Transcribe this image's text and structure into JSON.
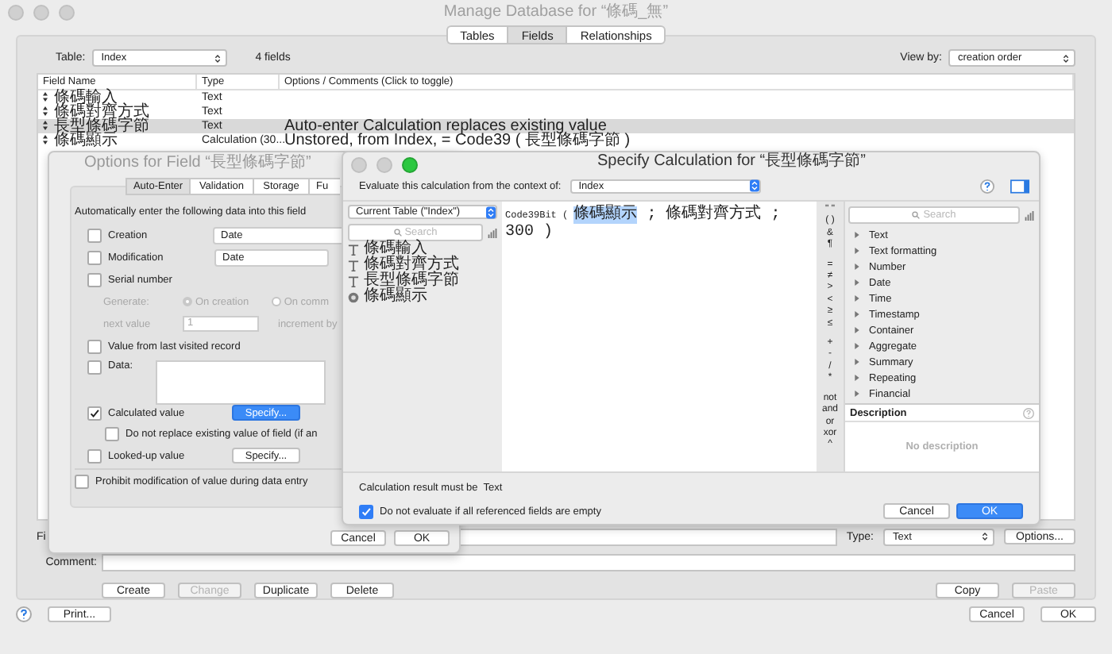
{
  "window": {
    "title": "Manage Database for “條碼_無”"
  },
  "tabs": [
    {
      "label": "Tables",
      "selected": false
    },
    {
      "label": "Fields",
      "selected": true
    },
    {
      "label": "Relationships",
      "selected": false
    }
  ],
  "table_picker": {
    "label": "Table:",
    "value": "Index"
  },
  "field_count": "4 fields",
  "view_by": {
    "label": "View by:",
    "value": "creation order"
  },
  "field_list": {
    "columns": [
      "Field Name",
      "Type",
      "Options / Comments  (Click to toggle)"
    ],
    "rows": [
      {
        "name": "條碼輸入",
        "type": "Text",
        "selected": false
      },
      {
        "name": "條碼對齊方式",
        "type": "Text",
        "selected": false
      },
      {
        "name": "長型條碼字節",
        "type": "Text",
        "options": "Auto-enter Calculation replaces existing value",
        "selected": true
      },
      {
        "name": "條碼顯示",
        "type": "Calculation (30...",
        "options": "Unstored, from Index, = Code39 ( 長型條碼字節 )",
        "selected": false
      }
    ]
  },
  "field_name": {
    "label": "Fi"
  },
  "type_picker": {
    "label": "Type:",
    "value": "Text"
  },
  "options_button": "Options...",
  "comment": {
    "label": "Comment:"
  },
  "edit_buttons": [
    {
      "label": "Create",
      "disabled": false
    },
    {
      "label": "Change",
      "disabled": true
    },
    {
      "label": "Duplicate",
      "disabled": false
    },
    {
      "label": "Delete",
      "disabled": false
    }
  ],
  "clipboard_buttons": [
    {
      "label": "Copy",
      "disabled": false
    },
    {
      "label": "Paste",
      "disabled": true
    }
  ],
  "footer": {
    "print": "Print...",
    "cancel": "Cancel",
    "ok": "OK"
  },
  "options_dialog": {
    "title": "Options for Field “長型條碼字節”",
    "tabs": [
      {
        "label": "Auto-Enter",
        "selected": true
      },
      {
        "label": "Validation",
        "selected": false
      },
      {
        "label": "Storage",
        "selected": false
      },
      {
        "label": "Fu",
        "selected": false
      }
    ],
    "heading": "Automatically enter the following data into this field",
    "rows": [
      {
        "kind": "checkbox_select",
        "label": "Creation",
        "checked": false,
        "value": "Date"
      },
      {
        "kind": "checkbox_select",
        "label": "Modification",
        "checked": false,
        "value": "Date"
      },
      {
        "kind": "checkbox",
        "label": "Serial number",
        "checked": false
      },
      {
        "kind": "radio_group",
        "label": "Generate:",
        "disabled": true,
        "options": [
          {
            "label": "On creation",
            "selected": true
          },
          {
            "label": "On comm",
            "selected": false
          }
        ]
      },
      {
        "kind": "text_field",
        "label": "next value",
        "disabled": true,
        "value": "1",
        "after": "increment by"
      },
      {
        "kind": "checkbox",
        "label": "Value from last visited record",
        "checked": false
      },
      {
        "kind": "checkbox_area",
        "label": "Data:",
        "checked": false
      },
      {
        "kind": "checkbox_button",
        "label": "Calculated value",
        "checked": true,
        "button": "Specify...",
        "primary": true
      },
      {
        "kind": "sub_checkbox",
        "label": "Do not replace existing value of field (if an",
        "checked": false
      },
      {
        "kind": "checkbox_button",
        "label": "Looked-up value",
        "checked": false,
        "button": "Specify...",
        "primary": false
      }
    ],
    "prohibit": {
      "label": "Prohibit modification of value during data entry",
      "checked": false
    },
    "cancel": "Cancel",
    "ok": "OK"
  },
  "calc_dialog": {
    "title": "Specify Calculation for “長型條碼字節”",
    "context_label": "Evaluate this calculation from the context of:",
    "context_value": "Index",
    "table_menu": "Current Table (\"Index\")",
    "field_search_placeholder": "Search",
    "fields": [
      {
        "name": "條碼輸入",
        "kind": "text"
      },
      {
        "name": "條碼對齊方式",
        "kind": "text"
      },
      {
        "name": "長型條碼字節",
        "kind": "text"
      },
      {
        "name": "條碼顯示",
        "kind": "calc"
      }
    ],
    "formula": [
      {
        "text": "Code39Bit ( ",
        "selected": false
      },
      {
        "text": "條碼顯示",
        "selected": true
      },
      {
        "text": " ; 條碼對齊方式 ; 300 )",
        "selected": false
      }
    ],
    "operators": [
      [
        "\" \"",
        "( )",
        "&",
        "¶"
      ],
      [
        "=",
        "≠",
        ">",
        "<",
        "≥",
        "≤"
      ],
      [
        "+",
        "-",
        "/",
        "*"
      ],
      [
        "not",
        "and",
        "or",
        "xor",
        "^"
      ]
    ],
    "function_search_placeholder": "Search",
    "function_categories": [
      "Text",
      "Text formatting",
      "Number",
      "Date",
      "Time",
      "Timestamp",
      "Container",
      "Aggregate",
      "Summary",
      "Repeating",
      "Financial"
    ],
    "description_title": "Description",
    "description_text": "No description",
    "result_note": "Calculation result must be  Text",
    "ignore_empty": {
      "label": "Do not evaluate if all referenced fields are empty",
      "checked": true
    },
    "cancel": "Cancel",
    "ok": "OK"
  }
}
